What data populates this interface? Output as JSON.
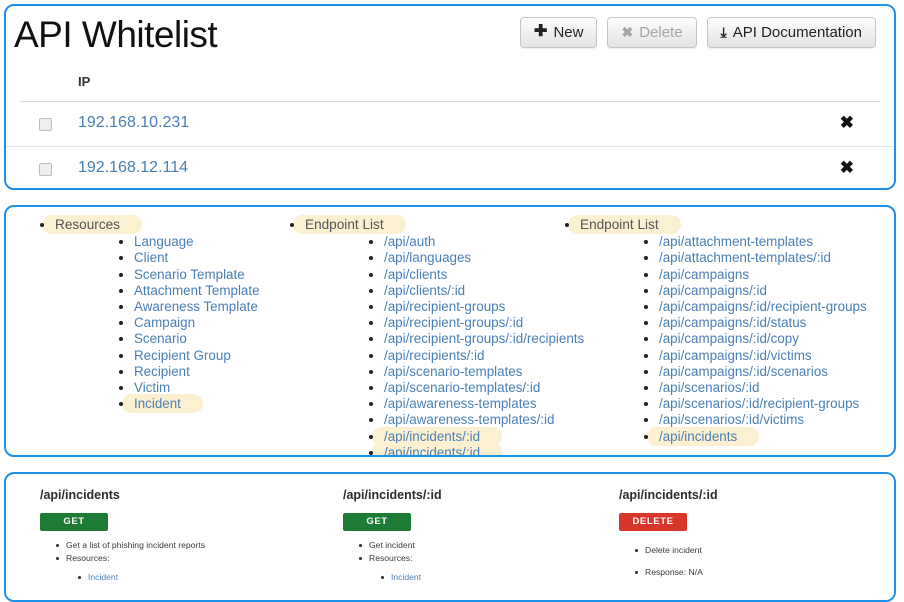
{
  "whitelist": {
    "title": "API Whitelist",
    "buttons": [
      {
        "label": "New",
        "icon": "plus-icon",
        "glyph": "✚",
        "disabled": false
      },
      {
        "label": "Delete",
        "icon": "cross-icon",
        "glyph": "✖",
        "disabled": true
      },
      {
        "label": "API Documentation",
        "icon": "download-icon",
        "glyph": "⤓",
        "disabled": false
      }
    ],
    "column_header": "IP",
    "rows": [
      {
        "ip": "192.168.10.231",
        "remove_glyph": "✖"
      },
      {
        "ip": "192.168.12.114",
        "remove_glyph": "✖"
      }
    ]
  },
  "api_lists": {
    "resources": {
      "root": "Resources",
      "root_highlighted": true,
      "items": [
        {
          "label": "Language",
          "highlighted": false
        },
        {
          "label": "Client",
          "highlighted": false
        },
        {
          "label": "Scenario Template",
          "highlighted": false
        },
        {
          "label": "Attachment Template",
          "highlighted": false
        },
        {
          "label": "Awareness Template",
          "highlighted": false
        },
        {
          "label": "Campaign",
          "highlighted": false
        },
        {
          "label": "Scenario",
          "highlighted": false
        },
        {
          "label": "Recipient Group",
          "highlighted": false
        },
        {
          "label": "Recipient",
          "highlighted": false
        },
        {
          "label": "Victim",
          "highlighted": false
        },
        {
          "label": "Incident",
          "highlighted": true
        }
      ]
    },
    "endpoints_1": {
      "root": "Endpoint List",
      "root_highlighted": true,
      "items": [
        {
          "label": "/api/auth",
          "highlighted": false
        },
        {
          "label": "/api/languages",
          "highlighted": false
        },
        {
          "label": "/api/clients",
          "highlighted": false
        },
        {
          "label": "/api/clients/:id",
          "highlighted": false
        },
        {
          "label": "/api/recipient-groups",
          "highlighted": false
        },
        {
          "label": "/api/recipient-groups/:id",
          "highlighted": false
        },
        {
          "label": "/api/recipient-groups/:id/recipients",
          "highlighted": false
        },
        {
          "label": "/api/recipients/:id",
          "highlighted": false
        },
        {
          "label": "/api/scenario-templates",
          "highlighted": false
        },
        {
          "label": "/api/scenario-templates/:id",
          "highlighted": false
        },
        {
          "label": "/api/awareness-templates",
          "highlighted": false
        },
        {
          "label": "/api/awareness-templates/:id",
          "highlighted": false
        },
        {
          "label": "/api/incidents/:id",
          "highlighted": true
        },
        {
          "label": "/api/incidents/:id",
          "highlighted": true
        }
      ]
    },
    "endpoints_2": {
      "root": "Endpoint List",
      "root_highlighted": true,
      "items": [
        {
          "label": "/api/attachment-templates",
          "highlighted": false
        },
        {
          "label": "/api/attachment-templates/:id",
          "highlighted": false
        },
        {
          "label": "/api/campaigns",
          "highlighted": false
        },
        {
          "label": "/api/campaigns/:id",
          "highlighted": false
        },
        {
          "label": "/api/campaigns/:id/recipient-groups",
          "highlighted": false
        },
        {
          "label": "/api/campaigns/:id/status",
          "highlighted": false
        },
        {
          "label": "/api/campaigns/:id/copy",
          "highlighted": false
        },
        {
          "label": "/api/campaigns/:id/victims",
          "highlighted": false
        },
        {
          "label": "/api/campaigns/:id/scenarios",
          "highlighted": false
        },
        {
          "label": "/api/scenarios/:id",
          "highlighted": false
        },
        {
          "label": "/api/scenarios/:id/recipient-groups",
          "highlighted": false
        },
        {
          "label": "/api/scenarios/:id/victims",
          "highlighted": false
        },
        {
          "label": "/api/incidents",
          "highlighted": true
        }
      ]
    }
  },
  "api_docs": [
    {
      "endpoint": "/api/incidents",
      "method": "GET",
      "method_color": "#1e7b33",
      "bullets": [
        "Get a list of phishing incident reports",
        "Resources:"
      ],
      "sub_bullets": [
        "Incident"
      ]
    },
    {
      "endpoint": "/api/incidents/:id",
      "method": "GET",
      "method_color": "#1e7b33",
      "bullets": [
        "Get incident",
        "Resources:"
      ],
      "sub_bullets": [
        "Incident"
      ]
    },
    {
      "endpoint": "/api/incidents/:id",
      "method": "DELETE",
      "method_color": "#d9362b",
      "bullets": [
        "Delete incident",
        "Response: N/A"
      ],
      "sub_bullets": []
    }
  ]
}
